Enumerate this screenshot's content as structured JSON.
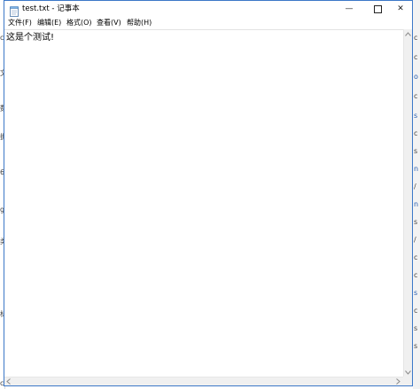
{
  "window": {
    "title": "test.txt - 记事本",
    "minimize_glyph": "—",
    "close_glyph": "✕"
  },
  "menu": {
    "file": "文件(F)",
    "edit": "编辑(E)",
    "format": "格式(O)",
    "view": "查看(V)",
    "help": "帮助(H)"
  },
  "editor": {
    "content": "这是个测试!"
  },
  "background": {
    "left_fragments": [
      "c",
      "文",
      "数",
      "据",
      "6",
      "g",
      "类",
      "标",
      "c"
    ],
    "right_fragments": [
      "c",
      "c",
      "o",
      "c",
      "s",
      "c",
      "s",
      "n",
      "/",
      "n",
      "s",
      "/",
      "c",
      "c",
      "s",
      "c",
      "s",
      "s"
    ]
  },
  "colors": {
    "window_border": "#3c78c8",
    "background_link": "#2a5fb0"
  }
}
